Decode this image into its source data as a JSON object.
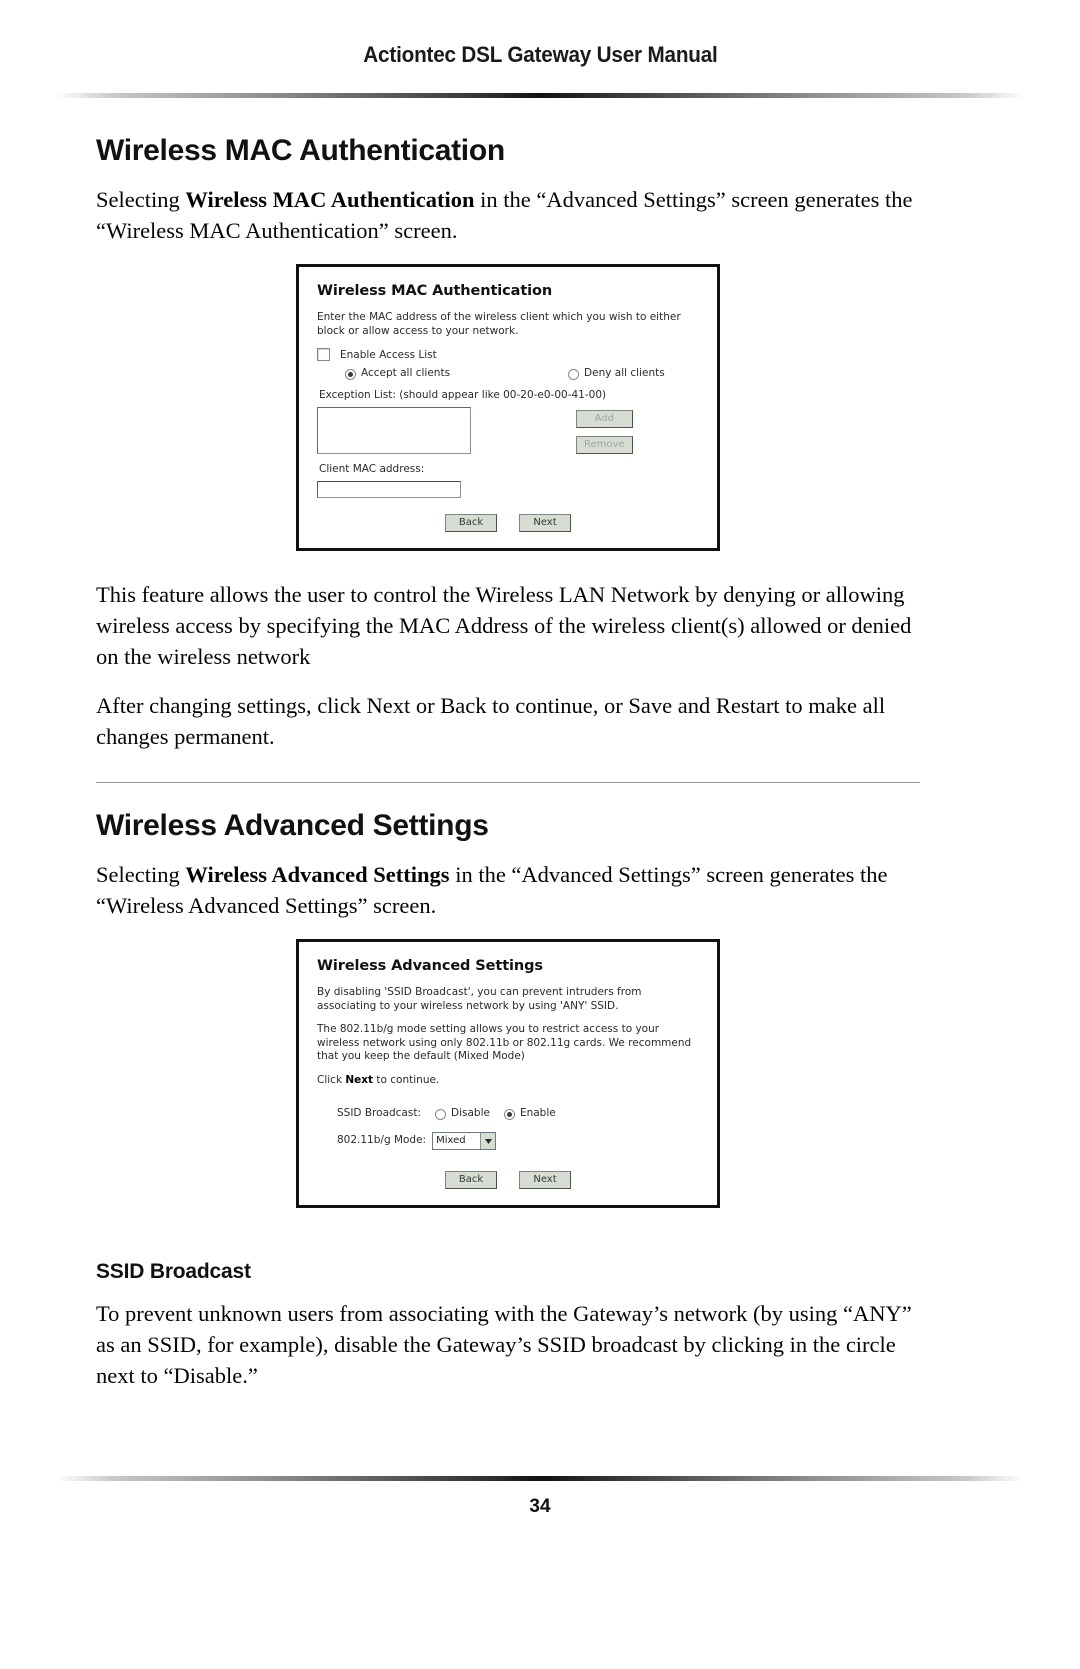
{
  "header": {
    "running_title": "Actiontec DSL Gateway User Manual"
  },
  "page_number": "34",
  "sections": [
    {
      "title": "Wireless MAC Authentication",
      "intro_prefix": "Selecting ",
      "intro_bold": "Wireless MAC Authentication",
      "intro_suffix": " in the “Advanced Settings” screen generates the “Wireless MAC Authentication” screen.",
      "after_paragraph_1": "This feature allows the user to control the Wireless LAN Network by denying or allowing wireless access by specifying the MAC Address of the wireless client(s) allowed or denied on the wireless network",
      "after_paragraph_2": "After changing settings, click Next or Back to continue, or Save and Restart to make all changes permanent."
    },
    {
      "title": "Wireless Advanced Settings",
      "intro_prefix": "Selecting ",
      "intro_bold": "Wireless Advanced Settings",
      "intro_suffix": " in the “Advanced Settings” screen generates the “Wireless Advanced Settings” screen.",
      "sub_title": "SSID Broadcast",
      "after_paragraph_1": "To prevent unknown users from associating with the Gateway’s network (by using “ANY” as an SSID, for example), disable the Gateway’s SSID broadcast by clicking in the circle next to “Disable.”"
    }
  ],
  "mac_auth_screen": {
    "title": "Wireless MAC Authentication",
    "description": "Enter the MAC address of the wireless client which you wish to either block or allow access to your network.",
    "enable_access_list_label": "Enable Access List",
    "enable_access_list_checked": false,
    "accept_all_label": "Accept all clients",
    "accept_all_selected": true,
    "deny_all_label": "Deny all clients",
    "deny_all_selected": false,
    "exception_list_label": "Exception List: (should appear like 00-20-e0-00-41-00)",
    "exception_list_value": "",
    "add_label": "Add",
    "remove_label": "Remove",
    "client_mac_label": "Client MAC address:",
    "client_mac_value": "",
    "back_label": "Back",
    "next_label": "Next"
  },
  "advanced_screen": {
    "title": "Wireless Advanced Settings",
    "paragraph_1": "By disabling 'SSID Broadcast', you can prevent intruders from associating to your wireless network by using 'ANY' SSID.",
    "paragraph_2": "The 802.11b/g mode setting allows you to restrict access to your wireless network using only 802.11b or 802.11g cards. We recommend that you keep the default (Mixed Mode)",
    "paragraph_3_prefix": "Click ",
    "paragraph_3_bold": "Next",
    "paragraph_3_suffix": " to continue.",
    "ssid_broadcast_label": "SSID Broadcast:",
    "ssid_disable_label": "Disable",
    "ssid_disable_selected": false,
    "ssid_enable_label": "Enable",
    "ssid_enable_selected": true,
    "mode_label": "802.11b/g Mode:",
    "mode_value": "Mixed",
    "back_label": "Back",
    "next_label": "Next"
  }
}
